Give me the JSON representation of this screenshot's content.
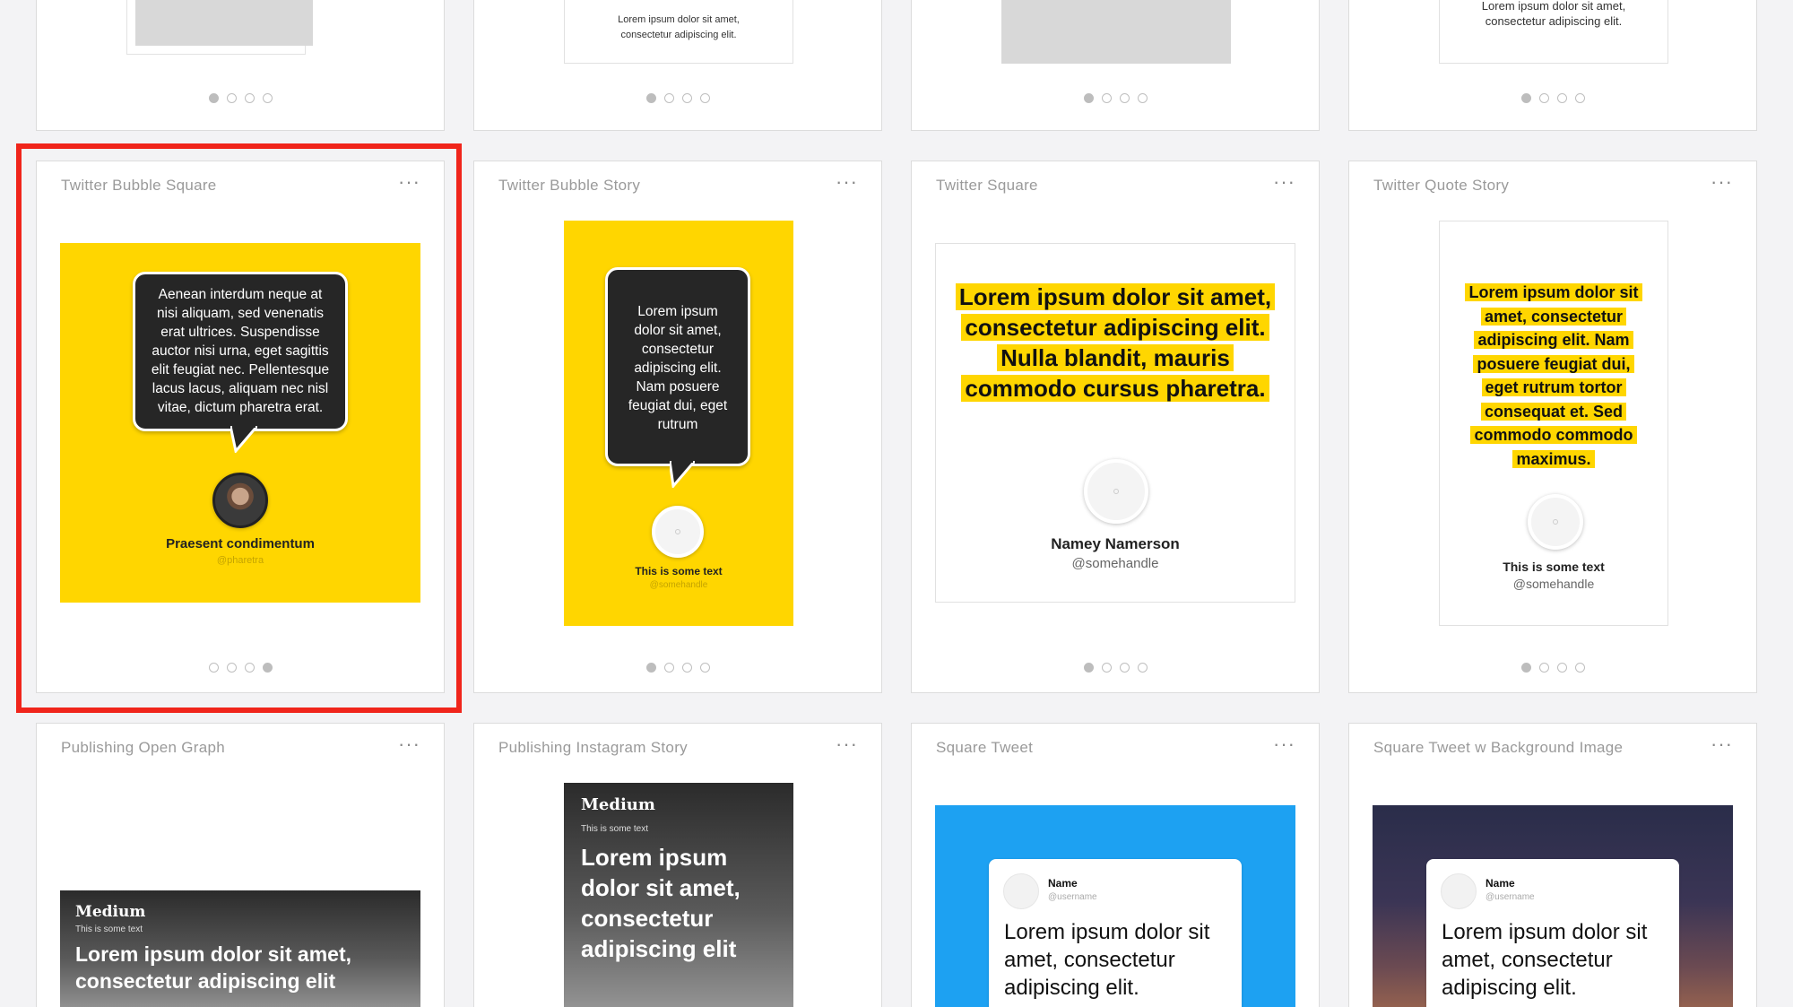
{
  "top_row": [
    {
      "type": "gray"
    },
    {
      "type": "text",
      "text_line1": "Lorem ipsum dolor sit amet,",
      "text_line2": "consectetur adipiscing elit."
    },
    {
      "type": "gray"
    },
    {
      "type": "text",
      "text_line1": "Lorem ipsum dolor sit amet,",
      "text_line2": "consectetur adipiscing elit."
    }
  ],
  "cards": {
    "bubble_square": {
      "title": "Twitter Bubble Square",
      "bubble_text": "Aenean interdum neque at nisi aliquam, sed venenatis erat ultrices. Suspendisse auctor nisi urna, eget sagittis elit feugiat nec. Pellentesque lacus lacus, aliquam nec nisl vitae, dictum pharetra erat.",
      "name": "Praesent condimentum",
      "handle": "@pharetra",
      "active_dot": 3
    },
    "bubble_story": {
      "title": "Twitter Bubble Story",
      "bubble_text": "Lorem ipsum dolor sit amet, consectetur adipiscing elit. Nam posuere feugiat dui, eget rutrum",
      "name": "This is some text",
      "handle": "@somehandle",
      "active_dot": 0
    },
    "twitter_square": {
      "title": "Twitter Square",
      "quote": "Lorem ipsum dolor sit amet, consectetur adipiscing elit. Nulla blandit, mauris commodo cursus pharetra.",
      "name": "Namey Namerson",
      "handle": "@somehandle",
      "active_dot": 0
    },
    "quote_story": {
      "title": "Twitter Quote Story",
      "quote": "Lorem ipsum dolor sit amet, consectetur adipiscing elit. Nam posuere feugiat dui, eget rutrum tortor consequat et. Sed commodo commodo maximus.",
      "name": "This is some text",
      "handle": "@somehandle",
      "active_dot": 0
    },
    "open_graph": {
      "title": "Publishing Open Graph",
      "brand": "Medium",
      "subtext": "This is some text",
      "headline": "Lorem ipsum dolor sit amet, consectetur adipiscing elit"
    },
    "instagram_story": {
      "title": "Publishing Instagram Story",
      "brand": "Medium",
      "subtext": "This is some text",
      "headline": "Lorem ipsum dolor sit amet, consectetur adipiscing elit"
    },
    "square_tweet": {
      "title": "Square Tweet",
      "name": "Name",
      "handle": "@username",
      "text": "Lorem ipsum dolor sit amet, consectetur adipiscing elit."
    },
    "square_tweet_bg": {
      "title": "Square Tweet w Background Image",
      "name": "Name",
      "handle": "@username",
      "text": "Lorem ipsum dolor sit amet, consectetur adipiscing elit."
    }
  },
  "more_label": "···",
  "top_row_active_dot": 0,
  "colors": {
    "yellow": "#ffd600",
    "selection": "#f0251b",
    "twitter_blue": "#1da1f2"
  }
}
